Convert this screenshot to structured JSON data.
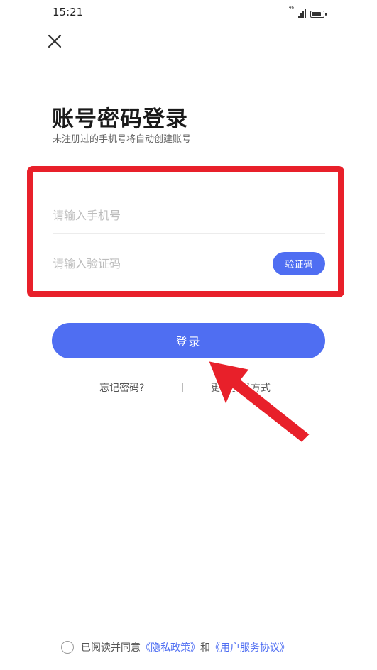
{
  "status_bar": {
    "time": "15:21",
    "signal_label": "⁴⁶",
    "battery_level": 0.85
  },
  "header": {
    "close_icon": "close-icon"
  },
  "login": {
    "title": "账号密码登录",
    "subtitle": "未注册过的手机号将自动创建账号",
    "phone_placeholder": "请输入手机号",
    "phone_value": "",
    "code_placeholder": "请输入验证码",
    "code_value": "",
    "code_button_label": "验证码",
    "login_button_label": "登录"
  },
  "links": {
    "forgot_password": "忘记密码?",
    "more_methods": "更多登录方式"
  },
  "agreement": {
    "prefix": "已阅读并同意",
    "privacy_policy": "《隐私政策》",
    "conjunction": "和",
    "user_agreement": "《用户服务协议》",
    "checked": false
  },
  "colors": {
    "accent": "#4f6ef2",
    "annotation_red": "#e8202a"
  }
}
